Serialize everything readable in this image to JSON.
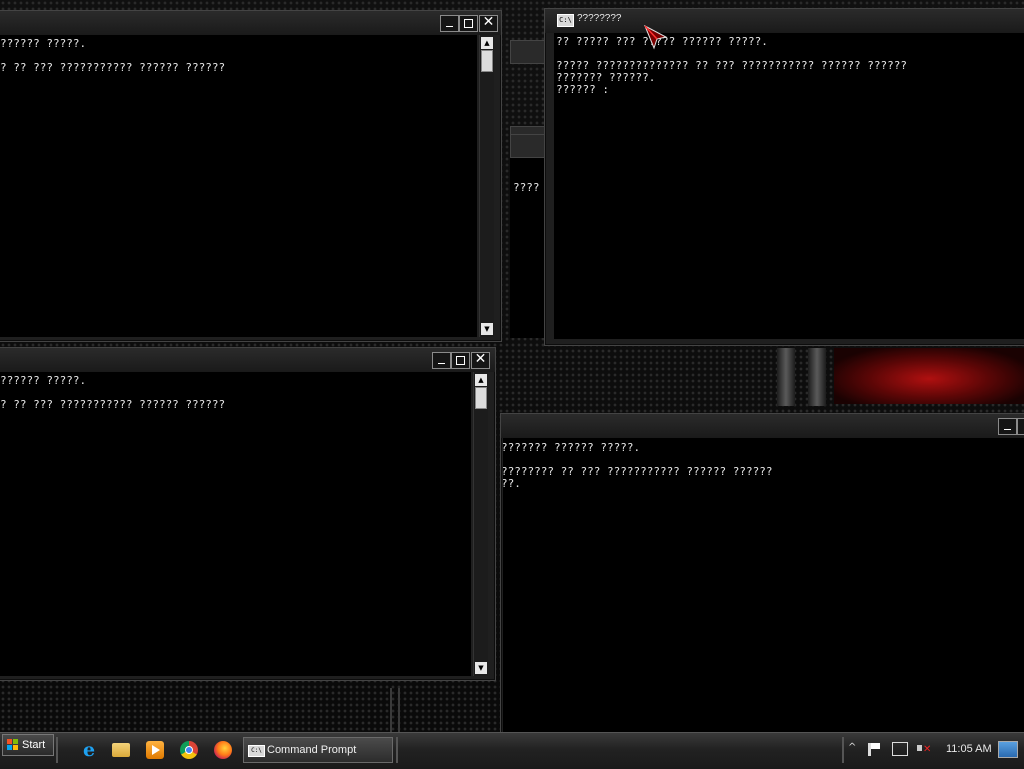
{
  "windows": {
    "top_left": {
      "lines": [
        "?????? ?????.",
        "",
        "? ?? ??? ??????????? ?????? ??????"
      ],
      "buttons": {
        "minimize": "_",
        "maximize": "□",
        "close": "✕"
      }
    },
    "bottom_left": {
      "lines": [
        "?????? ?????.",
        "",
        "? ?? ??? ??????????? ?????? ??????"
      ],
      "buttons": {
        "minimize": "_",
        "maximize": "□",
        "close": "✕"
      }
    },
    "top_right": {
      "title": "????????",
      "icon_text": "C:\\",
      "lines": [
        "?? ????? ??? ????? ?????? ?????.",
        "",
        "????? ?????????????? ?? ??? ??????????? ?????? ??????",
        "??????? ??????.",
        "?????? :"
      ]
    },
    "bottom_right": {
      "lines": [
        "??????? ?????? ?????.",
        "",
        "???????? ?? ??? ??????????? ?????? ??????",
        "??."
      ],
      "buttons": {
        "minimize": "_"
      }
    },
    "behind": {
      "fragment": "????"
    }
  },
  "taskbar": {
    "start_label": "Start",
    "quick_launch": [
      "ie-icon",
      "folder-icon",
      "media-player-icon",
      "chrome-icon",
      "firefox-icon"
    ],
    "ie_glyph": "e",
    "active_task": {
      "label": "Command Prompt",
      "icon_text": "C:\\"
    },
    "tray": {
      "show_hidden": "^",
      "clock": "11:05 AM"
    }
  },
  "colors": {
    "console_bg": "#000000",
    "console_text": "#e6e6e6",
    "window_frame": "#1f1f1f",
    "desktop_accent": "#b01010"
  }
}
